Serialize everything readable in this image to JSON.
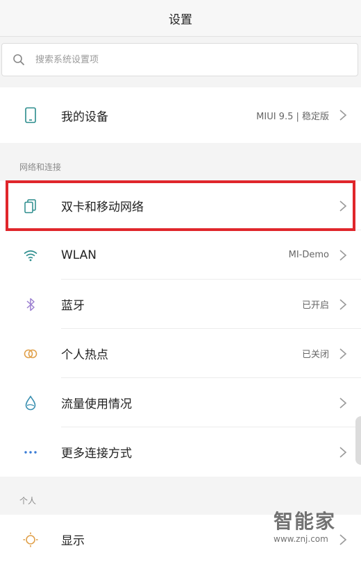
{
  "header": {
    "title": "设置"
  },
  "search": {
    "placeholder": "搜索系统设置项",
    "icon": "search-icon"
  },
  "device": {
    "label": "我的设备",
    "value": "MIUI 9.5 | 稳定版",
    "icon": "phone-icon"
  },
  "network_section": {
    "label": "网络和连接",
    "items": [
      {
        "label": "双卡和移动网络",
        "value": "",
        "icon": "sim-card-icon",
        "highlighted": true
      },
      {
        "label": "WLAN",
        "value": "MI-Demo",
        "icon": "wifi-icon"
      },
      {
        "label": "蓝牙",
        "value": "已开启",
        "icon": "bluetooth-icon"
      },
      {
        "label": "个人热点",
        "value": "已关闭",
        "icon": "hotspot-icon"
      },
      {
        "label": "流量使用情况",
        "value": "",
        "icon": "data-usage-icon"
      },
      {
        "label": "更多连接方式",
        "value": "",
        "icon": "more-dots-icon"
      }
    ]
  },
  "personal_section": {
    "label": "个人",
    "items": [
      {
        "label": "显示",
        "value": "",
        "icon": "display-sun-icon"
      }
    ]
  },
  "watermark": {
    "big": "智能家",
    "small": "www.znj.com"
  },
  "colors": {
    "highlight_border": "#e0262b",
    "icon_teal": "#2a8c8c",
    "icon_blue": "#3a7bd5",
    "icon_purple": "#9b7fd0",
    "icon_orange": "#e0a04a"
  }
}
